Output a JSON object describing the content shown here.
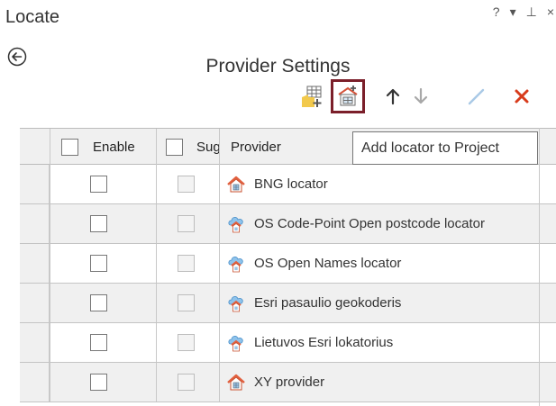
{
  "window": {
    "title": "Locate",
    "controls": [
      "?",
      "▾",
      "⊥",
      "×"
    ]
  },
  "header": {
    "title": "Provider Settings"
  },
  "toolbar": {
    "buttons": [
      {
        "name": "add-locator-from-table",
        "icon": "table-add-icon"
      },
      {
        "name": "add-locator-to-project",
        "icon": "locator-add-icon",
        "selected": true
      },
      {
        "name": "move-up",
        "icon": "arrow-up-icon"
      },
      {
        "name": "move-down",
        "icon": "arrow-down-icon"
      },
      {
        "name": "edit",
        "icon": "pencil-icon"
      },
      {
        "name": "remove",
        "icon": "close-icon"
      }
    ],
    "tooltip": "Add locator to Project"
  },
  "grid": {
    "columns": {
      "enable": "Enable",
      "suggest": "Sug",
      "provider": "Provider"
    },
    "rows": [
      {
        "provider": "BNG locator",
        "icon": "house-locator-icon",
        "enable": false,
        "suggest": false
      },
      {
        "provider": "OS Code-Point Open postcode locator",
        "icon": "cloud-locator-icon",
        "enable": false,
        "suggest": false
      },
      {
        "provider": "OS Open Names locator",
        "icon": "cloud-locator-icon",
        "enable": false,
        "suggest": false
      },
      {
        "provider": "Esri pasaulio geokoderis",
        "icon": "cloud-locator-icon",
        "enable": false,
        "suggest": false
      },
      {
        "provider": "Lietuvos Esri lokatorius",
        "icon": "cloud-locator-icon",
        "enable": false,
        "suggest": false
      },
      {
        "provider": "XY provider",
        "icon": "house-locator-icon",
        "enable": false,
        "suggest": false
      }
    ]
  },
  "colors": {
    "selected_border": "#7b1f2a",
    "remove_red": "#d83b1b",
    "alt_row": "#f0f0f0"
  }
}
